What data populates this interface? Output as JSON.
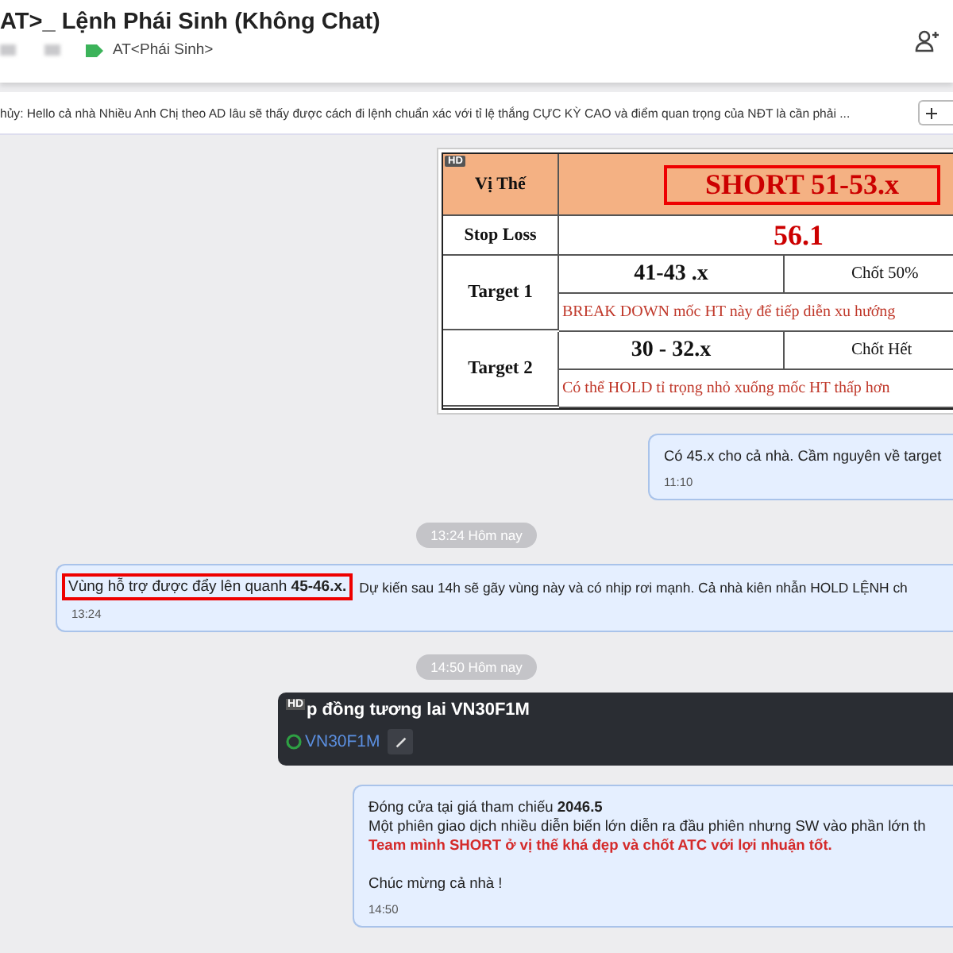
{
  "header": {
    "title": "AT>_ Lệnh Phái Sinh (Không Chat)",
    "tag": "AT<Phái Sinh>"
  },
  "pinned": {
    "text": "hủy: Hello cả nhà Nhiều Anh Chị theo AD lâu sẽ thấy được cách đi lệnh chuẩn xác với tỉ lệ thắng CỰC KỲ CAO và điểm quan trọng của NĐT là cần phải ..."
  },
  "messages": [
    {
      "kind": "table_image",
      "badge": "HD",
      "position": {
        "label": "Vị Thế",
        "value": "SHORT 51-53.x"
      },
      "stop_loss": {
        "label": "Stop Loss",
        "value": "56.1"
      },
      "targets": [
        {
          "label": "Target 1",
          "range": "41-43 .x",
          "action": "Chốt 50%",
          "note": "BREAK DOWN mốc HT này để tiếp diễn xu hướng"
        },
        {
          "label": "Target 2",
          "range": "30 - 32.x",
          "action": "Chốt Hết",
          "note": "Có thể HOLD tỉ trọng nhỏ xuống mốc HT thấp hơn"
        }
      ]
    },
    {
      "kind": "outgoing",
      "paragraphs": [
        [
          {
            "text": "Có 45.x cho cả nhà. Cầm nguyên về target",
            "alert": false
          }
        ]
      ],
      "time": "11:10"
    },
    {
      "kind": "divider",
      "text": "13:24 Hôm nay"
    },
    {
      "kind": "incoming",
      "segments": [
        {
          "text": "Vùng hỗ trợ được đẩy lên quanh **45-46.x.**",
          "highlighted": true
        },
        {
          "text": "Dự kiến sau 14h sẽ gãy vùng này và có nhịp rơi mạnh. Cả nhà kiên nhẫn HOLD LỆNH ch",
          "highlighted": false
        }
      ],
      "time": "13:24"
    },
    {
      "kind": "divider",
      "text": "14:50 Hôm nay"
    },
    {
      "kind": "product",
      "badge": "HD",
      "title": "p đồng tương lai VN30F1M",
      "symbol": "VN30F1M"
    },
    {
      "kind": "outgoing",
      "paragraphs": [
        [
          {
            "text": "Đóng cửa tại giá tham chiếu **2046.5**",
            "alert": false
          },
          {
            "text": "Một phiên giao dịch nhiều diễn biến lớn diễn ra đầu phiên nhưng SW vào phần lớn th",
            "alert": false
          },
          {
            "text": "Team mình SHORT ở vị thế khá đẹp và chốt ATC với lợi nhuận tốt.",
            "alert": true
          }
        ],
        [
          {
            "text": "Chúc mừng cả nhà !",
            "alert": false
          }
        ]
      ],
      "time": "14:50"
    }
  ]
}
